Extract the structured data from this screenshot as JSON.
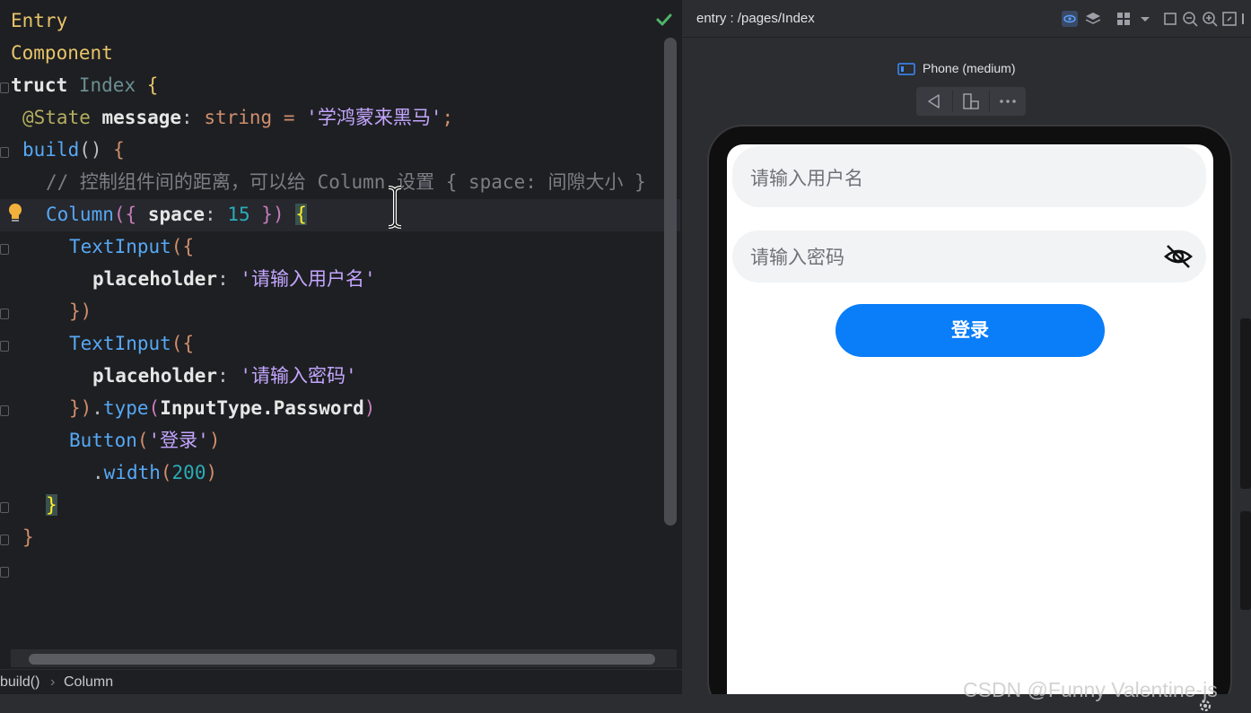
{
  "editor": {
    "lines": {
      "l1": {
        "kw": "Entry"
      },
      "l2": {
        "kw": "Component"
      },
      "l3": {
        "kw": "truct",
        "name": "Index",
        "brace": "{"
      },
      "l4": {
        "dec": "@State",
        "id": "message",
        "colon": ":",
        "type": "string",
        "eq": "=",
        "str": "'学鸿蒙来黑马'",
        "end": ";"
      },
      "l5": {
        "fn": "build",
        "parens": "()",
        "brace": "{"
      },
      "l6": {
        "comment": "// 控制组件间的距离，可以给 Column 设置 { space: 间隙大小 }"
      },
      "l7": {
        "fn": "Column",
        "open": "({",
        "key": "space",
        "colon": ":",
        "num": "15",
        "close": "})",
        "brace": "{"
      },
      "l8": {
        "fn": "TextInput",
        "open": "({"
      },
      "l9": {
        "key": "placeholder",
        "colon": ":",
        "str": "'请输入用户名'"
      },
      "l10": {
        "close": "})"
      },
      "l11": {
        "fn": "TextInput",
        "open": "({"
      },
      "l12": {
        "key": "placeholder",
        "colon": ":",
        "str": "'请输入密码'"
      },
      "l13": {
        "close": "})",
        "dot": ".",
        "method": "type",
        "open": "(",
        "arg": "InputType.Password",
        "end": ")"
      },
      "l14": {
        "fn": "Button",
        "open": "(",
        "str": "'登录'",
        "end": ")"
      },
      "l15": {
        "dot": ".",
        "method": "width",
        "open": "(",
        "num": "200",
        "end": ")"
      },
      "l16": {
        "brace": "}"
      },
      "l17": {
        "brace": "}"
      }
    },
    "status_icon": "check-icon"
  },
  "breadcrumb": {
    "items": [
      "build()",
      "Column"
    ],
    "separator": "›"
  },
  "preview": {
    "path": "entry : /pages/Index",
    "device": "Phone (medium)",
    "app": {
      "username_placeholder": "请输入用户名",
      "password_placeholder": "请输入密码",
      "login_label": "登录",
      "password_visibility_icon": "eye-off-icon"
    }
  },
  "watermark": "CSDN @Funny Valentine-js",
  "colors": {
    "editor_bg": "#1e1f22",
    "accent_blue": "#0a7df8",
    "string": "#c3a6ff",
    "keyword": "#cf8e6d"
  }
}
